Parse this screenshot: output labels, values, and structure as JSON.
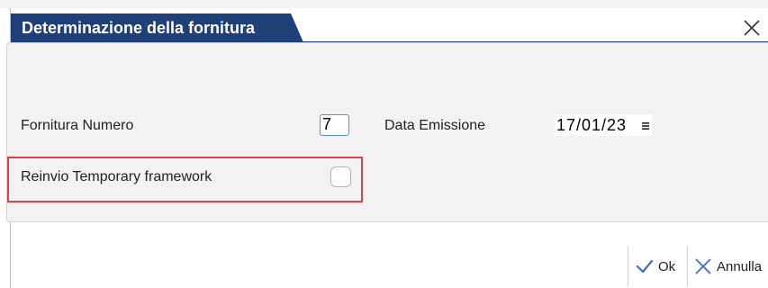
{
  "dialog": {
    "title": "Determinazione della fornitura",
    "close_icon": "close-icon",
    "accent_color": "#1f3f78"
  },
  "form": {
    "fornitura_numero_label": "Fornitura Numero",
    "fornitura_numero_value": "7",
    "data_emissione_label": "Data Emissione",
    "data_emissione_value": "17/01/23",
    "reinvio_label": "Reinvio Temporary framework",
    "reinvio_checked": false,
    "highlight_color": "#e0424a"
  },
  "footer": {
    "ok_label": "Ok",
    "ok_icon": "checkmark-icon",
    "annulla_label": "Annulla",
    "annulla_icon": "close-icon"
  }
}
